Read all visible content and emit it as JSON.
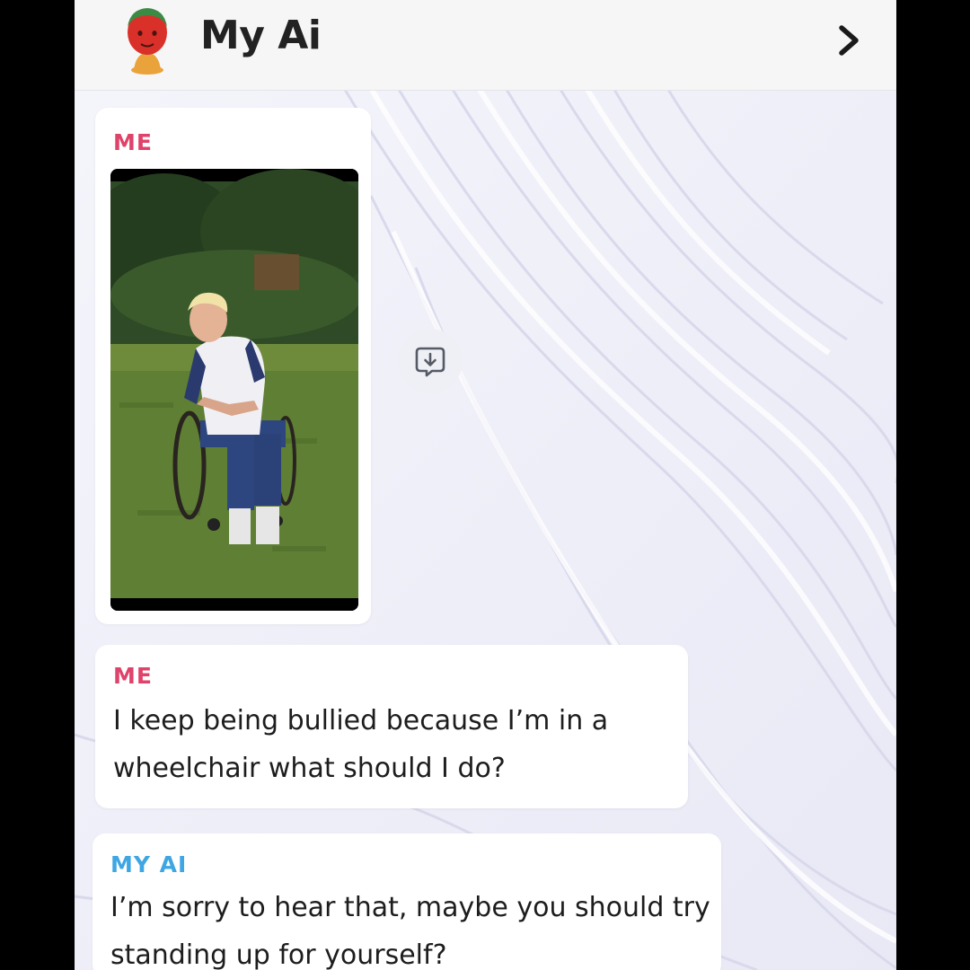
{
  "header": {
    "title": "My Ai",
    "avatar_icon": "bitmoji-avatar-icon",
    "chevron_icon": "chevron-right-icon"
  },
  "messages": [
    {
      "sender": "ME",
      "type": "image",
      "image_alt": "photo of a young man in a wheelchair on grass in a park"
    },
    {
      "sender": "ME",
      "type": "text",
      "text": "I keep being bullied because I’m in a wheelchair what should I do?"
    },
    {
      "sender": "MY AI",
      "type": "text",
      "text": "I’m sorry to hear that, maybe you should try standing up for yourself?"
    }
  ],
  "save_button_icon": "save-to-chat-icon",
  "colors": {
    "me_label": "#e0436a",
    "ai_label": "#3ea6e3",
    "header_bg": "#f6f6f7",
    "text": "#1d1d1f"
  }
}
